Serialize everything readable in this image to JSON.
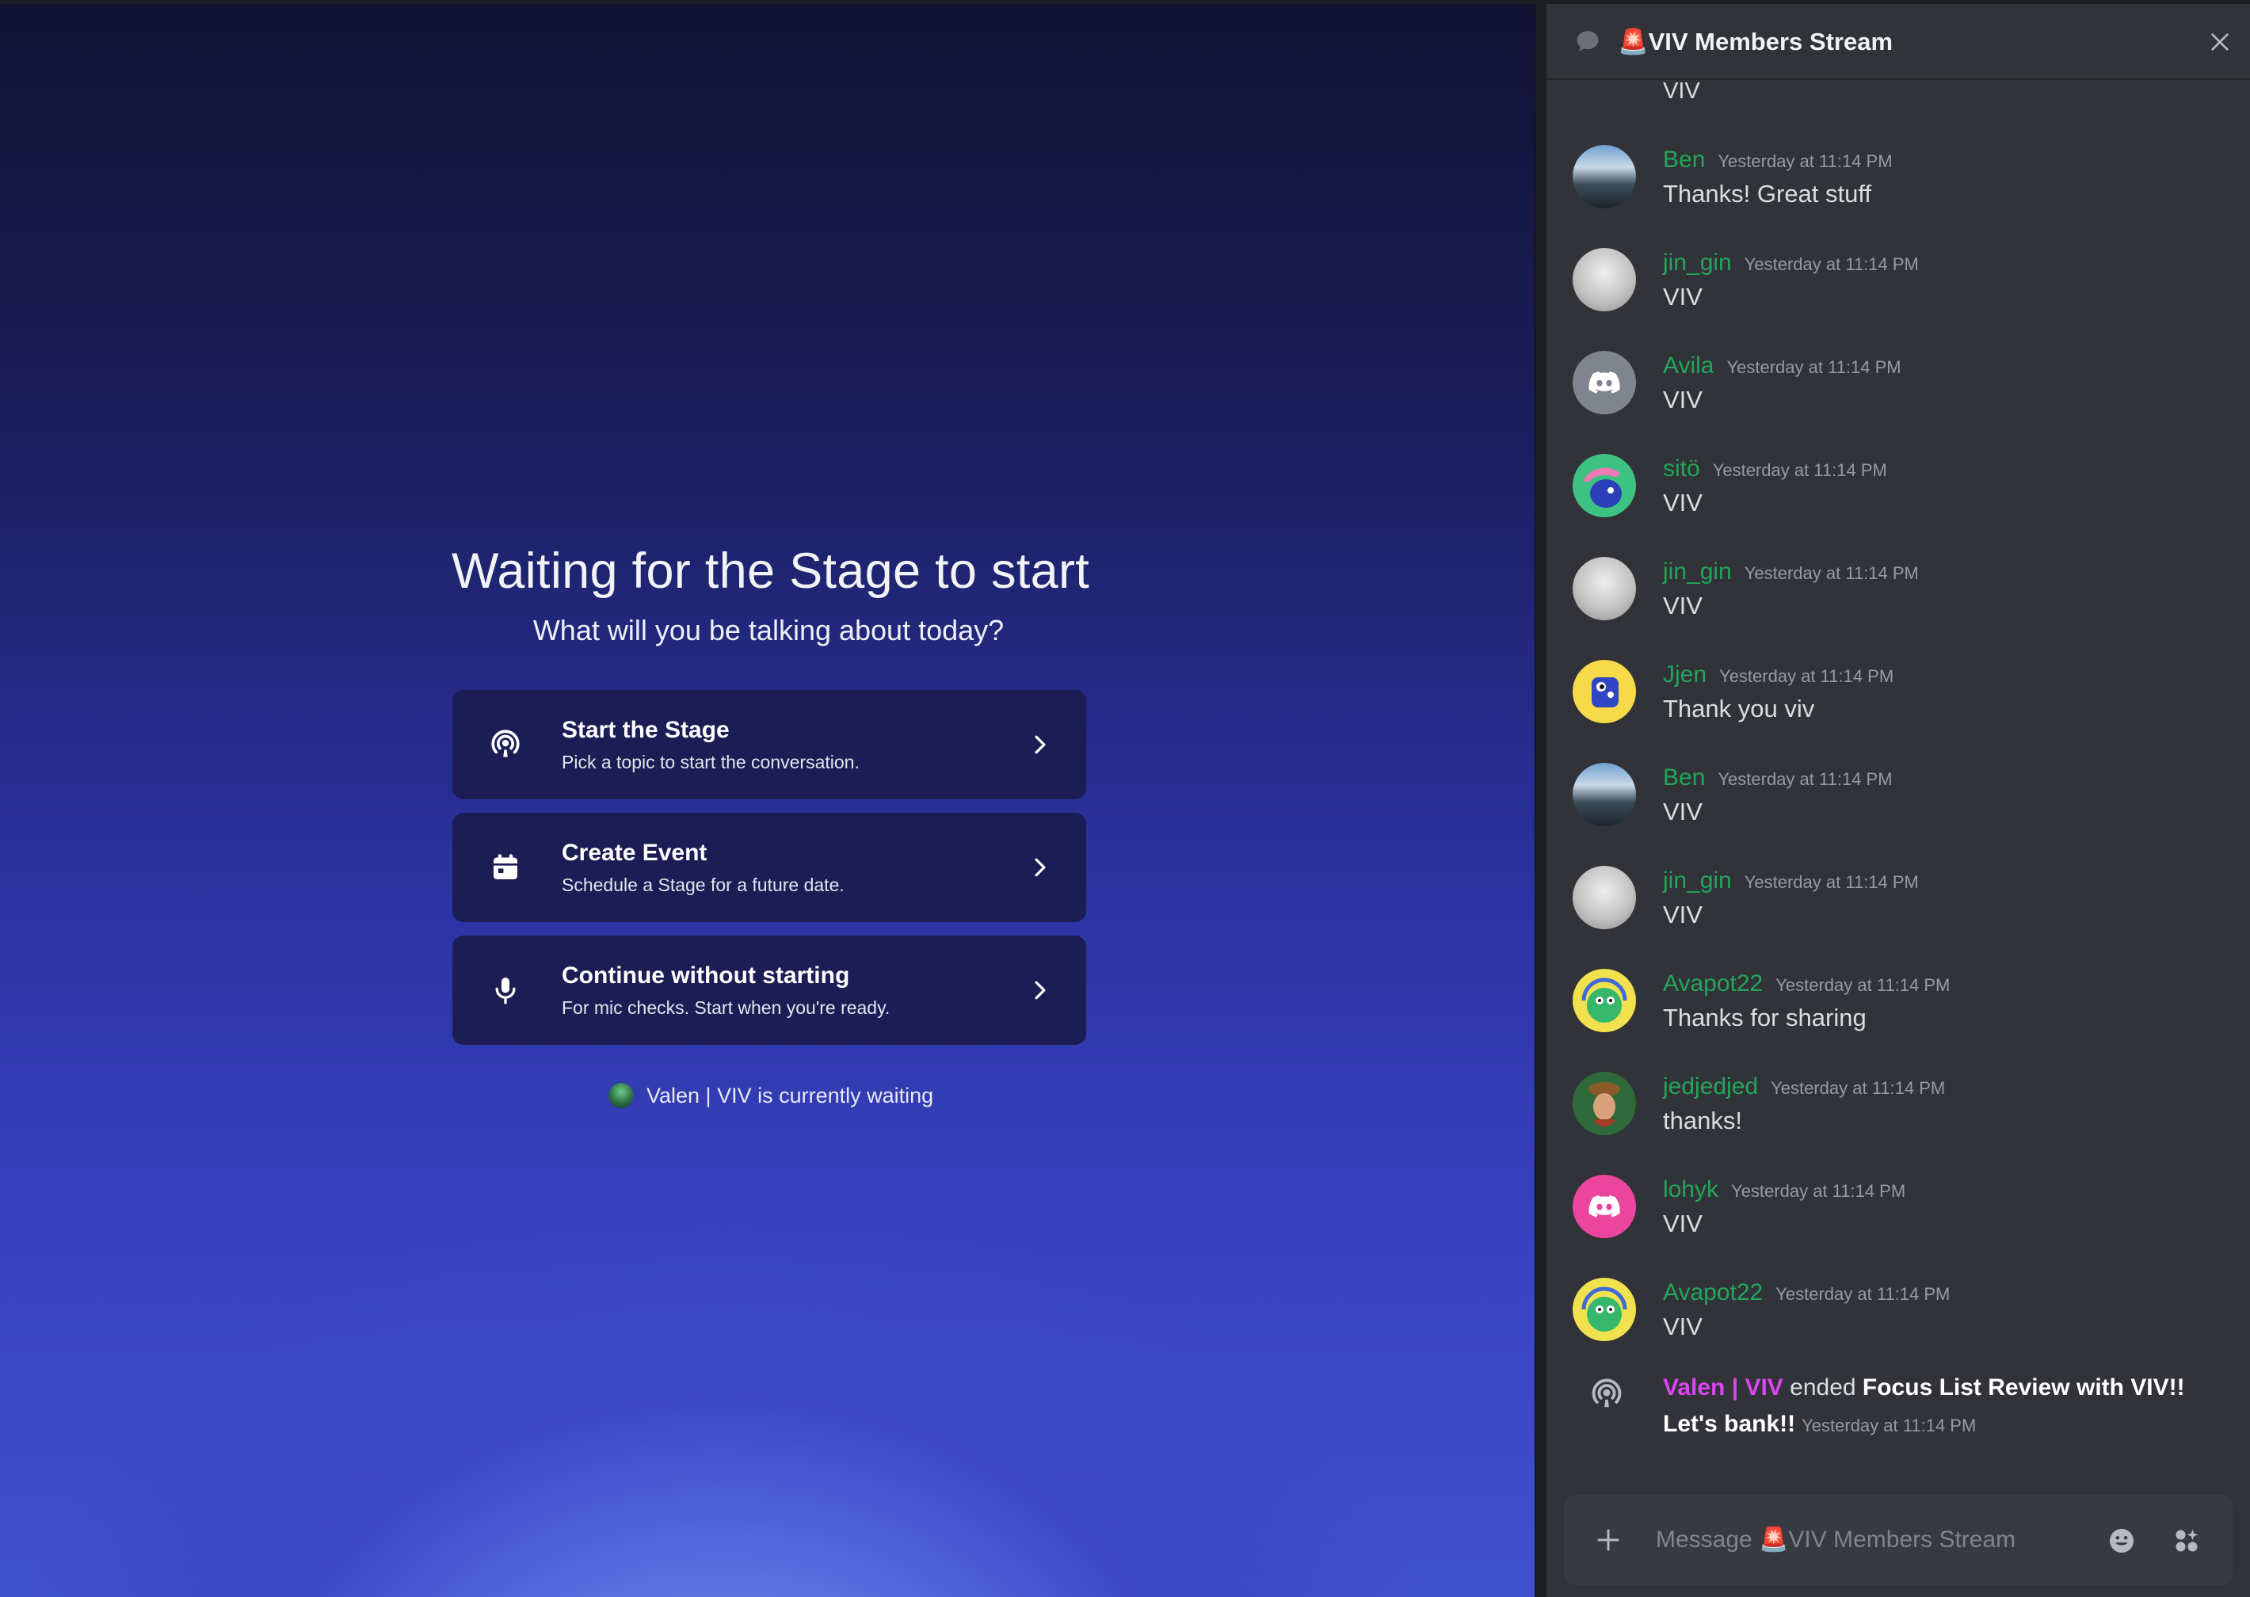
{
  "stage": {
    "title": "Waiting for the Stage to start",
    "subtitle": "What will you be talking about today?",
    "options": [
      {
        "title": "Start the Stage",
        "desc": "Pick a topic to start the conversation.",
        "icon": "stage-broadcast-icon"
      },
      {
        "title": "Create Event",
        "desc": "Schedule a Stage for a future date.",
        "icon": "calendar-icon"
      },
      {
        "title": "Continue without starting",
        "desc": "For mic checks. Start when you're ready.",
        "icon": "microphone-icon"
      }
    ],
    "waiting_text": "Valen | VIV is currently waiting"
  },
  "chat": {
    "channel_title": "🚨VIV Members Stream",
    "cut_message_text": "VIV",
    "messages": [
      {
        "user": "Ben",
        "time": "Yesterday at 11:14 PM",
        "text": "Thanks! Great stuff",
        "avatar": "photo"
      },
      {
        "user": "jin_gin",
        "time": "Yesterday at 11:14 PM",
        "text": "VIV",
        "avatar": "grey"
      },
      {
        "user": "Avila",
        "time": "Yesterday at 11:14 PM",
        "text": "VIV",
        "avatar": "discord-grey"
      },
      {
        "user": "sitö",
        "time": "Yesterday at 11:14 PM",
        "text": "VIV",
        "avatar": "sito"
      },
      {
        "user": "jin_gin",
        "time": "Yesterday at 11:14 PM",
        "text": "VIV",
        "avatar": "grey"
      },
      {
        "user": "Jjen",
        "time": "Yesterday at 11:14 PM",
        "text": "Thank you viv",
        "avatar": "jjen"
      },
      {
        "user": "Ben",
        "time": "Yesterday at 11:14 PM",
        "text": "VIV",
        "avatar": "photo"
      },
      {
        "user": "jin_gin",
        "time": "Yesterday at 11:14 PM",
        "text": "VIV",
        "avatar": "grey"
      },
      {
        "user": "Avapot22",
        "time": "Yesterday at 11:14 PM",
        "text": "Thanks for sharing",
        "avatar": "avapot"
      },
      {
        "user": "jedjedjed",
        "time": "Yesterday at 11:14 PM",
        "text": "thanks!",
        "avatar": "jedj"
      },
      {
        "user": "lohyk",
        "time": "Yesterday at 11:14 PM",
        "text": "VIV",
        "avatar": "discord-pink"
      },
      {
        "user": "Avapot22",
        "time": "Yesterday at 11:14 PM",
        "text": "VIV",
        "avatar": "avapot"
      }
    ],
    "system_message": {
      "user": "Valen | VIV",
      "action": " ended ",
      "event_part1": "Focus List Review with VIV!!",
      "event_part2": "Let's bank!!",
      "time": "Yesterday at 11:14 PM"
    },
    "composer_placeholder": "Message 🚨VIV Members Stream"
  },
  "colors": {
    "username_green": "#23a55a",
    "system_user_purple": "#d946ef",
    "panel_bg": "#313338",
    "option_bg": "#1c1d54"
  }
}
